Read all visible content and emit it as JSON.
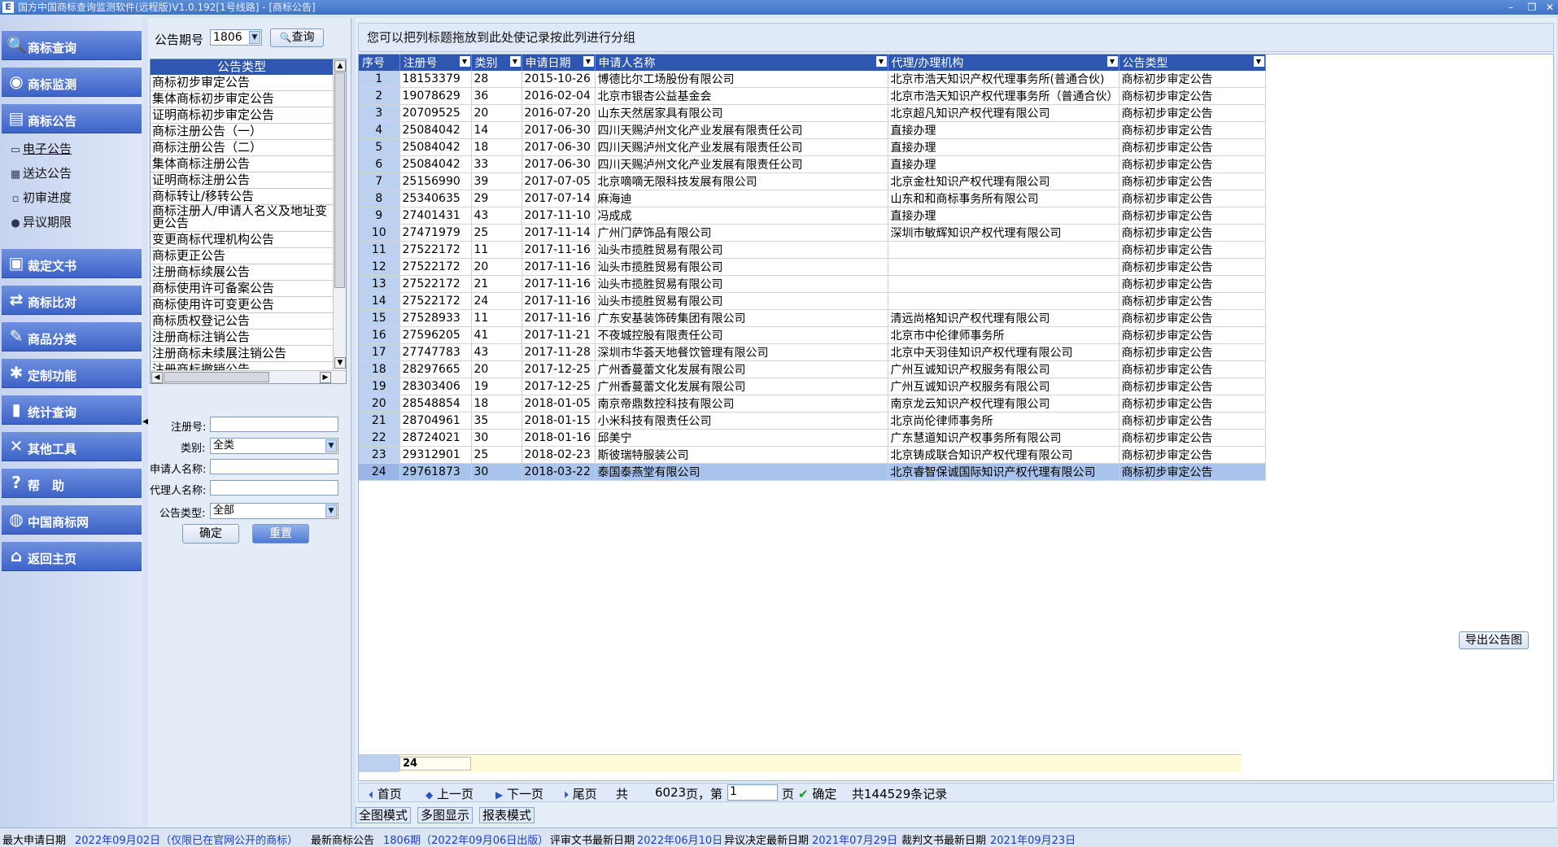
{
  "window": {
    "title": "国方中国商标查询监测软件(远程版)V1.0.192[1号线路] - [商标公告]",
    "app_icon": "E"
  },
  "nav": {
    "buttons": [
      {
        "label": "商标查询",
        "icon": "magnifier-icon"
      },
      {
        "label": "商标监测",
        "icon": "globe-icon"
      },
      {
        "label": "商标公告",
        "icon": "document-icon"
      },
      {
        "label": "裁定文书",
        "icon": "ruling-document-icon"
      },
      {
        "label": "商标比对",
        "icon": "compare-icon"
      },
      {
        "label": "商品分类",
        "icon": "classify-icon"
      },
      {
        "label": "定制功能",
        "icon": "custom-icon"
      },
      {
        "label": "统计查询",
        "icon": "statistics-icon"
      },
      {
        "label": "其他工具",
        "icon": "tools-icon"
      },
      {
        "label": "帮　助",
        "icon": "help-icon"
      },
      {
        "label": "中国商标网",
        "icon": "web-icon"
      },
      {
        "label": "返回主页",
        "icon": "home-icon"
      }
    ],
    "subitems": [
      {
        "label": "电子公告",
        "icon": "e-notice-icon",
        "active": true
      },
      {
        "label": "送达公告",
        "icon": "delivery-icon",
        "active": false
      },
      {
        "label": "初审进度",
        "icon": "progress-icon",
        "active": false
      },
      {
        "label": "异议期限",
        "icon": "deadline-icon",
        "active": false
      }
    ]
  },
  "filter": {
    "issue_label": "公告期号",
    "issue_value": "1806",
    "query_button": "查询",
    "list_header": "公告类型",
    "list_items": [
      "商标初步审定公告",
      "集体商标初步审定公告",
      "证明商标初步审定公告",
      "商标注册公告（一）",
      "商标注册公告（二）",
      "集体商标注册公告",
      "证明商标注册公告",
      "商标转让/移转公告",
      "商标注册人/申请人名义及地址变更公告",
      "变更商标代理机构公告",
      "商标更正公告",
      "注册商标续展公告",
      "商标使用许可备案公告",
      "商标使用许可变更公告",
      "商标质权登记公告",
      "注册商标注销公告",
      "注册商标未续展注销公告",
      "注册商标撤销公告"
    ],
    "reg_no_label": "注册号:",
    "reg_no_value": "",
    "class_label": "类别:",
    "class_value": "全类",
    "applicant_label": "申请人名称:",
    "applicant_value": "",
    "agent_label": "代理人名称:",
    "agent_value": "",
    "type_label": "公告类型:",
    "type_value": "全部",
    "confirm_button": "确定",
    "reset_button": "重置"
  },
  "grid": {
    "group_hint": "您可以把列标题拖放到此处使记录按此列进行分组",
    "columns": [
      "序号",
      "注册号",
      "类别",
      "申请日期",
      "申请人名称",
      "代理/办理机构",
      "公告类型"
    ],
    "rows": [
      [
        "1",
        "18153379",
        "28",
        "2015-10-26",
        "博德比尔工场股份有限公司",
        "北京市浩天知识产权代理事务所(普通合伙)",
        "商标初步审定公告"
      ],
      [
        "2",
        "19078629",
        "36",
        "2016-02-04",
        "北京市银杏公益基金会",
        "北京市浩天知识产权代理事务所（普通合伙）",
        "商标初步审定公告"
      ],
      [
        "3",
        "20709525",
        "20",
        "2016-07-20",
        "山东天然居家具有限公司",
        "北京超凡知识产权代理有限公司",
        "商标初步审定公告"
      ],
      [
        "4",
        "25084042",
        "14",
        "2017-06-30",
        "四川天赐泸州文化产业发展有限责任公司",
        "直接办理",
        "商标初步审定公告"
      ],
      [
        "5",
        "25084042",
        "18",
        "2017-06-30",
        "四川天赐泸州文化产业发展有限责任公司",
        "直接办理",
        "商标初步审定公告"
      ],
      [
        "6",
        "25084042",
        "33",
        "2017-06-30",
        "四川天赐泸州文化产业发展有限责任公司",
        "直接办理",
        "商标初步审定公告"
      ],
      [
        "7",
        "25156990",
        "39",
        "2017-07-05",
        "北京嘀嘀无限科技发展有限公司",
        "北京金杜知识产权代理有限公司",
        "商标初步审定公告"
      ],
      [
        "8",
        "25340635",
        "29",
        "2017-07-14",
        "麻海迪",
        "山东和和商标事务所有限公司",
        "商标初步审定公告"
      ],
      [
        "9",
        "27401431",
        "43",
        "2017-11-10",
        "冯成成",
        "直接办理",
        "商标初步审定公告"
      ],
      [
        "10",
        "27471979",
        "25",
        "2017-11-14",
        "广州门萨饰品有限公司",
        "深圳市敏辉知识产权代理有限公司",
        "商标初步审定公告"
      ],
      [
        "11",
        "27522172",
        "11",
        "2017-11-16",
        "汕头市揽胜贸易有限公司",
        "",
        "商标初步审定公告"
      ],
      [
        "12",
        "27522172",
        "20",
        "2017-11-16",
        "汕头市揽胜贸易有限公司",
        "",
        "商标初步审定公告"
      ],
      [
        "13",
        "27522172",
        "21",
        "2017-11-16",
        "汕头市揽胜贸易有限公司",
        "",
        "商标初步审定公告"
      ],
      [
        "14",
        "27522172",
        "24",
        "2017-11-16",
        "汕头市揽胜贸易有限公司",
        "",
        "商标初步审定公告"
      ],
      [
        "15",
        "27528933",
        "11",
        "2017-11-16",
        "广东安基装饰砖集团有限公司",
        "清远尚格知识产权代理有限公司",
        "商标初步审定公告"
      ],
      [
        "16",
        "27596205",
        "41",
        "2017-11-21",
        "不夜城控股有限责任公司",
        "北京市中伦律师事务所",
        "商标初步审定公告"
      ],
      [
        "17",
        "27747783",
        "43",
        "2017-11-28",
        "深圳市华荟天地餐饮管理有限公司",
        "北京中天羽佳知识产权代理有限公司",
        "商标初步审定公告"
      ],
      [
        "18",
        "28297665",
        "20",
        "2017-12-25",
        "广州香蔓蕾文化发展有限公司",
        "广州互诚知识产权服务有限公司",
        "商标初步审定公告"
      ],
      [
        "19",
        "28303406",
        "19",
        "2017-12-25",
        "广州香蔓蕾文化发展有限公司",
        "广州互诚知识产权服务有限公司",
        "商标初步审定公告"
      ],
      [
        "20",
        "28548854",
        "18",
        "2018-01-05",
        "南京帝鼎数控科技有限公司",
        "南京龙云知识产权代理有限公司",
        "商标初步审定公告"
      ],
      [
        "21",
        "28704961",
        "35",
        "2018-01-15",
        "小米科技有限责任公司",
        "北京尚伦律师事务所",
        "商标初步审定公告"
      ],
      [
        "22",
        "28724021",
        "30",
        "2018-01-16",
        "邱美宁",
        "广东慧道知识产权事务所有限公司",
        "商标初步审定公告"
      ],
      [
        "23",
        "29312901",
        "25",
        "2018-02-23",
        "斯彼瑞特服装公司",
        "北京铸成联合知识产权代理有限公司",
        "商标初步审定公告"
      ],
      [
        "24",
        "29761873",
        "30",
        "2018-03-22",
        "泰国泰燕堂有限公司",
        "北京睿智保诚国际知识产权代理有限公司",
        "商标初步审定公告"
      ]
    ],
    "selected_row": 24,
    "record_count": "24"
  },
  "pager": {
    "first": "首页",
    "prev": "上一页",
    "next": "下一页",
    "last": "尾页",
    "total_prefix": "共",
    "total_pages": "6023",
    "page_mid": "页，第",
    "current_page": "1",
    "page_suffix": "页",
    "confirm": "确定",
    "total_records": "共144529条记录",
    "export_button": "导出公告图"
  },
  "mode_tabs": [
    "全图模式",
    "多图显示",
    "报表模式"
  ],
  "statusbar": {
    "latest_app_date_label": "最大申请日期",
    "latest_app_date_value": "2022年09月02日（仅限已在官网公开的商标）",
    "latest_notice_label": "最新商标公告",
    "latest_notice_value": "1806期（2022年09月06日出版）",
    "review_doc_label": "评审文书最新日期",
    "review_doc_value": "2022年06月10日",
    "objection_label": "异议决定最新日期",
    "objection_value": "2021年07月29日",
    "ruling_label": "裁判文书最新日期",
    "ruling_value": "2021年09月23日"
  },
  "colors": {
    "header_blue": "#2f56b0",
    "nav_blue": "#3c63c7",
    "selected_row": "#a8c3ec",
    "status_value": "#1c3fc0"
  }
}
